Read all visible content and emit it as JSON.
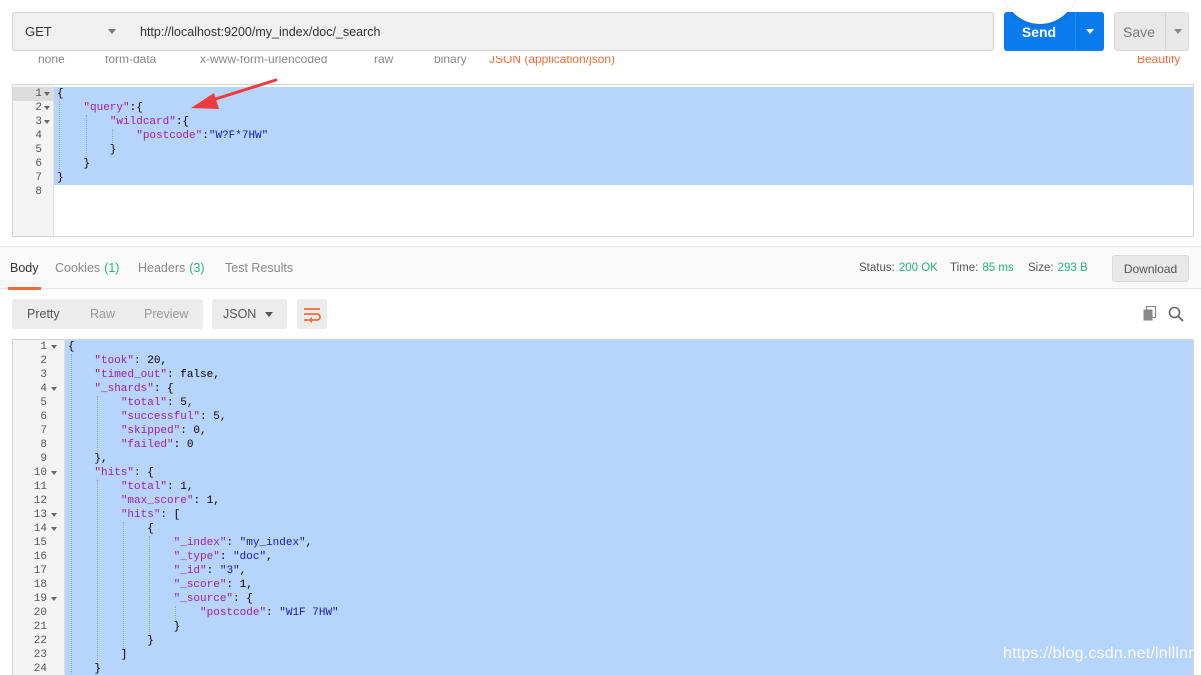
{
  "request": {
    "method": "GET",
    "url": "http://localhost:9200/my_index/doc/_search",
    "send_label": "Send",
    "save_label": "Save"
  },
  "body_types": {
    "none": "none",
    "form_data": "form-data",
    "urlencoded": "x-www-form-urlencoded",
    "raw": "raw",
    "binary": "binary",
    "json_type": "JSON (application/json)",
    "beautify": "Beautify"
  },
  "request_editor": {
    "line_numbers": [
      "1",
      "2",
      "3",
      "4",
      "5",
      "6",
      "7",
      "8"
    ],
    "lines": [
      [
        {
          "t": "p",
          "v": "{"
        }
      ],
      [
        {
          "t": "p",
          "v": "    "
        },
        {
          "t": "k",
          "v": "\"query\""
        },
        {
          "t": "p",
          "v": ":{"
        }
      ],
      [
        {
          "t": "p",
          "v": "        "
        },
        {
          "t": "k",
          "v": "\"wildcard\""
        },
        {
          "t": "p",
          "v": ":{"
        }
      ],
      [
        {
          "t": "p",
          "v": "            "
        },
        {
          "t": "k",
          "v": "\"postcode\""
        },
        {
          "t": "p",
          "v": ":"
        },
        {
          "t": "s",
          "v": "\"W?F*7HW\""
        }
      ],
      [
        {
          "t": "p",
          "v": "        }"
        }
      ],
      [
        {
          "t": "p",
          "v": "    }"
        }
      ],
      [
        {
          "t": "p",
          "v": "}"
        }
      ],
      []
    ]
  },
  "response": {
    "tabs": {
      "body": "Body",
      "cookies": "Cookies",
      "cookies_count": "(1)",
      "headers": "Headers",
      "headers_count": "(3)",
      "tests": "Test Results"
    },
    "status_label": "Status:",
    "status_value": "200 OK",
    "time_label": "Time:",
    "time_value": "85 ms",
    "size_label": "Size:",
    "size_value": "293 B",
    "download_label": "Download",
    "format_options": {
      "pretty": "Pretty",
      "raw": "Raw",
      "preview": "Preview"
    },
    "language": "JSON"
  },
  "response_editor": {
    "line_numbers": [
      "1",
      "2",
      "3",
      "4",
      "5",
      "6",
      "7",
      "8",
      "9",
      "10",
      "11",
      "12",
      "13",
      "14",
      "15",
      "16",
      "17",
      "18",
      "19",
      "20",
      "21",
      "22",
      "23",
      "24"
    ],
    "lines": [
      [
        {
          "t": "p",
          "v": "{"
        }
      ],
      [
        {
          "t": "p",
          "v": "    "
        },
        {
          "t": "k",
          "v": "\"took\""
        },
        {
          "t": "p",
          "v": ": 20,"
        }
      ],
      [
        {
          "t": "p",
          "v": "    "
        },
        {
          "t": "k",
          "v": "\"timed_out\""
        },
        {
          "t": "p",
          "v": ": false,"
        }
      ],
      [
        {
          "t": "p",
          "v": "    "
        },
        {
          "t": "k",
          "v": "\"_shards\""
        },
        {
          "t": "p",
          "v": ": {"
        }
      ],
      [
        {
          "t": "p",
          "v": "        "
        },
        {
          "t": "k",
          "v": "\"total\""
        },
        {
          "t": "p",
          "v": ": 5,"
        }
      ],
      [
        {
          "t": "p",
          "v": "        "
        },
        {
          "t": "k",
          "v": "\"successful\""
        },
        {
          "t": "p",
          "v": ": 5,"
        }
      ],
      [
        {
          "t": "p",
          "v": "        "
        },
        {
          "t": "k",
          "v": "\"skipped\""
        },
        {
          "t": "p",
          "v": ": 0,"
        }
      ],
      [
        {
          "t": "p",
          "v": "        "
        },
        {
          "t": "k",
          "v": "\"failed\""
        },
        {
          "t": "p",
          "v": ": 0"
        }
      ],
      [
        {
          "t": "p",
          "v": "    },"
        }
      ],
      [
        {
          "t": "p",
          "v": "    "
        },
        {
          "t": "k",
          "v": "\"hits\""
        },
        {
          "t": "p",
          "v": ": {"
        }
      ],
      [
        {
          "t": "p",
          "v": "        "
        },
        {
          "t": "k",
          "v": "\"total\""
        },
        {
          "t": "p",
          "v": ": 1,"
        }
      ],
      [
        {
          "t": "p",
          "v": "        "
        },
        {
          "t": "k",
          "v": "\"max_score\""
        },
        {
          "t": "p",
          "v": ": 1,"
        }
      ],
      [
        {
          "t": "p",
          "v": "        "
        },
        {
          "t": "k",
          "v": "\"hits\""
        },
        {
          "t": "p",
          "v": ": ["
        }
      ],
      [
        {
          "t": "p",
          "v": "            {"
        }
      ],
      [
        {
          "t": "p",
          "v": "                "
        },
        {
          "t": "k",
          "v": "\"_index\""
        },
        {
          "t": "p",
          "v": ": "
        },
        {
          "t": "s",
          "v": "\"my_index\""
        },
        {
          "t": "p",
          "v": ","
        }
      ],
      [
        {
          "t": "p",
          "v": "                "
        },
        {
          "t": "k",
          "v": "\"_type\""
        },
        {
          "t": "p",
          "v": ": "
        },
        {
          "t": "s",
          "v": "\"doc\""
        },
        {
          "t": "p",
          "v": ","
        }
      ],
      [
        {
          "t": "p",
          "v": "                "
        },
        {
          "t": "k",
          "v": "\"_id\""
        },
        {
          "t": "p",
          "v": ": "
        },
        {
          "t": "s",
          "v": "\"3\""
        },
        {
          "t": "p",
          "v": ","
        }
      ],
      [
        {
          "t": "p",
          "v": "                "
        },
        {
          "t": "k",
          "v": "\"_score\""
        },
        {
          "t": "p",
          "v": ": 1,"
        }
      ],
      [
        {
          "t": "p",
          "v": "                "
        },
        {
          "t": "k",
          "v": "\"_source\""
        },
        {
          "t": "p",
          "v": ": {"
        }
      ],
      [
        {
          "t": "p",
          "v": "                    "
        },
        {
          "t": "k",
          "v": "\"postcode\""
        },
        {
          "t": "p",
          "v": ": "
        },
        {
          "t": "s",
          "v": "\"W1F 7HW\""
        }
      ],
      [
        {
          "t": "p",
          "v": "                }"
        }
      ],
      [
        {
          "t": "p",
          "v": "            }"
        }
      ],
      [
        {
          "t": "p",
          "v": "        ]"
        }
      ],
      [
        {
          "t": "p",
          "v": "    }"
        }
      ]
    ]
  },
  "watermark": "https://blog.csdn.net/lnlllnn",
  "colors": {
    "send_blue": "#097bed",
    "accent_orange": "#f26b3a",
    "status_green": "#26b47f",
    "selection": "#b6d4fc",
    "json_key": "#a31f9c",
    "json_string": "#1a1aa6"
  }
}
